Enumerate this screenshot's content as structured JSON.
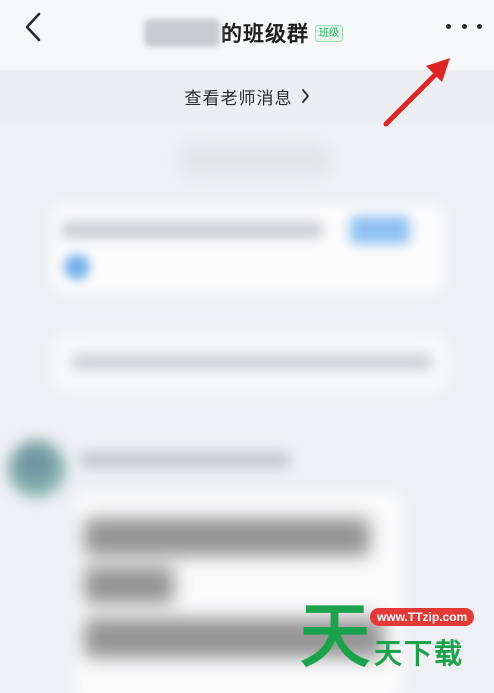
{
  "header": {
    "back_icon": "chevron-left-icon",
    "title_suffix": "的班级群",
    "badge": "班级",
    "more_icon": "more-dots-icon"
  },
  "teacher_bar": {
    "label": "查看老师消息",
    "chevron": "›"
  },
  "watermark": {
    "url": "www.TTzip.com",
    "text": "天下载",
    "logo_char": "天"
  },
  "colors": {
    "accent_green": "#2bae66",
    "arrow_red": "#e02424",
    "watermark_green": "#1aa34a"
  }
}
